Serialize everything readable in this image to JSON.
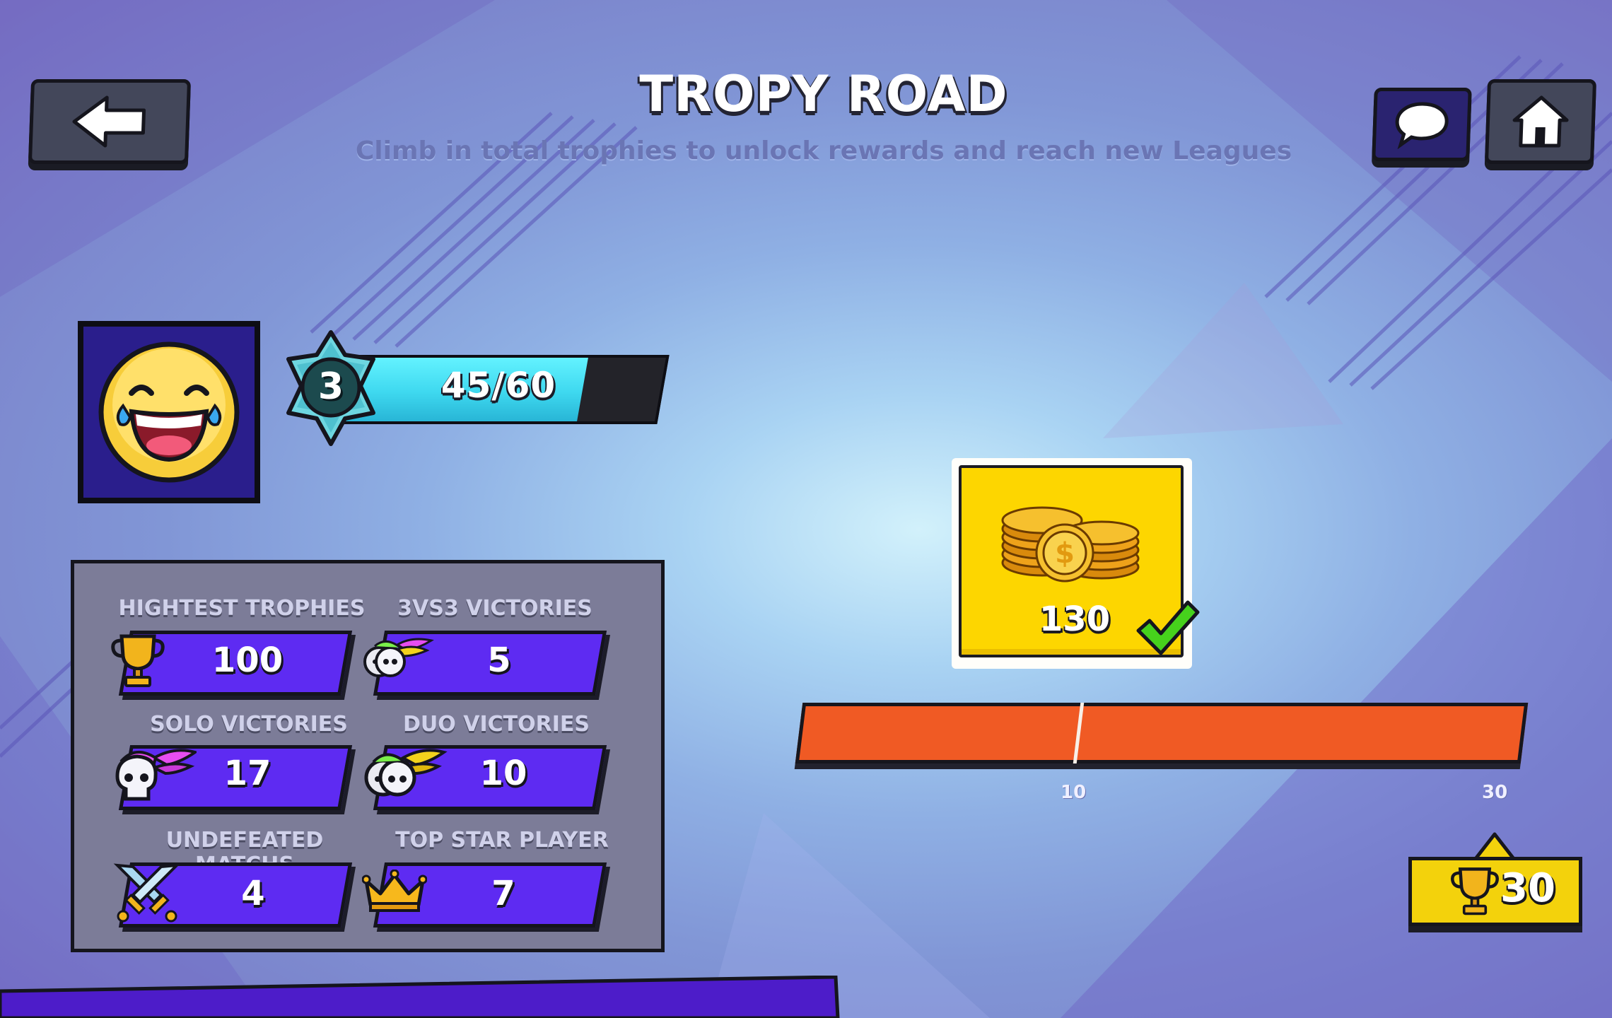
{
  "header": {
    "title": "TROPY ROAD",
    "subtitle": "Climb in total trophies to unlock rewards and reach new Leagues"
  },
  "buttons": {
    "back": "back-arrow-icon",
    "chat": "chat-bubble-icon",
    "home": "home-icon"
  },
  "player": {
    "avatar": "laughing-emoji-icon",
    "level": "3",
    "xp_text": "45/60",
    "xp_progress": 0.75
  },
  "stats": {
    "highest_trophies": {
      "label": "HIGHTEST TROPHIES",
      "value": "100",
      "icon": "trophy-icon"
    },
    "victories_3v3": {
      "label": "3VS3 VICTORIES",
      "value": "5",
      "icon": "triple-skull-icon"
    },
    "solo_victories": {
      "label": "SOLO VICTORIES",
      "value": "17",
      "icon": "winged-skull-icon"
    },
    "duo_victories": {
      "label": "DUO VICTORIES",
      "value": "10",
      "icon": "double-skull-icon"
    },
    "undefeated_matches": {
      "label": "UNDEFEATED MATCHS",
      "value": "4",
      "icon": "crossed-swords-icon"
    },
    "top_star_player": {
      "label": "TOP STAR PLAYER",
      "value": "7",
      "icon": "crown-icon"
    }
  },
  "reward": {
    "amount": "130",
    "icon": "coin-stack-icon",
    "claimed": true
  },
  "track": {
    "ticks": [
      "10",
      "30"
    ]
  },
  "trophies": {
    "current": "30",
    "icon": "trophy-icon"
  },
  "colors": {
    "stat_bar": "#5e2bf2",
    "xp_fill": "#3ed8ef",
    "track": "#f05a24",
    "reward_card": "#fdd600",
    "badge": "#f3d20c"
  }
}
